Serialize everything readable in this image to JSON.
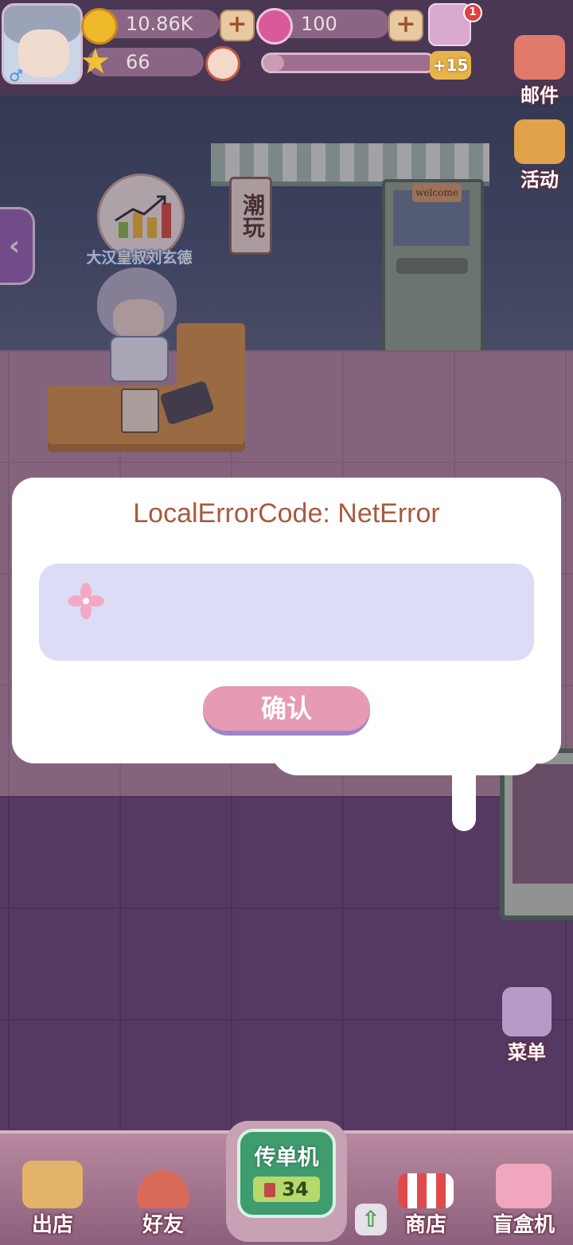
{
  "topbar": {
    "coins": "10.86K",
    "gems": "100",
    "stars": "66",
    "level_badge": "+15",
    "notification_count": "1",
    "progress_fraction": 0.12
  },
  "side": {
    "mail_label": "邮件",
    "activity_label": "活动",
    "menu_label": "菜单"
  },
  "scene": {
    "owner_name": "大汉皇叔刘玄德",
    "shop_sign": "潮玩",
    "welcome": "welcome"
  },
  "dialog": {
    "title": "LocalErrorCode: NetError",
    "message": "",
    "confirm_label": "确认"
  },
  "bottom": {
    "out_label": "出店",
    "friends_label": "好友",
    "flyer_label": "传单机",
    "flyer_count": "34",
    "shop_label": "商店",
    "blindbox_label": "盲盒机"
  },
  "colors": {
    "dialog_title": "#a85a3e",
    "confirm_button": "#e79ab4",
    "message_box": "#dcdcf6"
  }
}
